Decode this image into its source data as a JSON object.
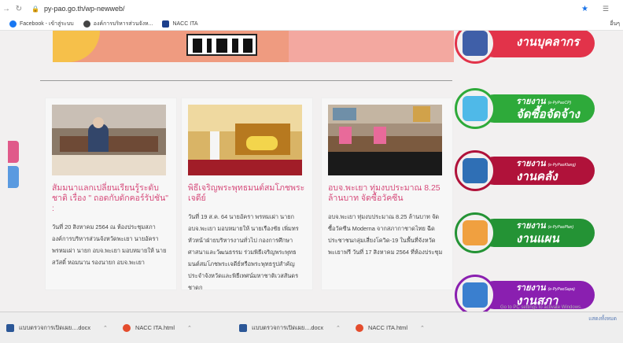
{
  "browser": {
    "url": "py-pao.go.th/wp-newweb/",
    "bookmarks": [
      {
        "label": "Facebook - เข้าสู่ระบบ",
        "color": "#1877f2"
      },
      {
        "label": "องค์การบริหารส่วนจังห...",
        "color": "#444444"
      },
      {
        "label": "NACC ITA",
        "color": "#1c3f8c"
      }
    ],
    "bookmarks_right": "อื่นๆ"
  },
  "articles": [
    {
      "title": "สัมมนาแลกเปลี่ยนเรียนรู้ระดับชาติ เรื่อง \" ถอดกับดักคอร์รัปชัน\" :",
      "body": "วันที่ 20 สิงหาคม 2564 ณ ห้องประชุมสภาองค์การบริหารส่วนจังหวัดพะเยา นายอัครา พรหมเผ่า นายก อบจ.พะเยา มอบหมายให้ นายสวัสดิ์ หอมนาน รองนายก อบจ.พะเยา"
    },
    {
      "title": "พิธีเจริญพระพุทธมนต์สมโภชพระเจดีย์",
      "body": "วันที่ 19 ส.ค. 64 นายอัครา พรหมเผ่า นายก อบจ.พะเยา มอบหมายให้ นายเรืองชัย เพิ่มทรหัวหน้าฝ่ายบริหารงานทั่วไป กองการศึกษา ศาสนาและวัฒนธรรม ร่วมพิธีเจริญพระพุทธมนต์สมโภชพระเจดีย์หรือพระพุทธรูปสำคัญประจำจังหวัดและพิธีเทศน์มหาชาติเวสสันดรชาดก"
    },
    {
      "title": "อบจ.พะเยา ทุ่มงบประมาณ 8.25 ล้านบาท จัดซื้อวัคซีน",
      "body": "อบจ.พะเยา ทุ่มงบประมาณ 8.25 ล้านบาท จัดซื้อวัคซีน Moderna จากสภากาชาดไทย ฉีดประชาชนกลุ่มเสี่ยงโควิด-19 ในพื้นที่จังหวัดพะเยาฟรี วันที่ 17 สิงหาคม 2564 ที่ห้องประชุม"
    }
  ],
  "side_links": [
    {
      "l1": "",
      "sub": "",
      "l2": "งานบุคลากร",
      "color": "#e2334a"
    },
    {
      "l1": "รายงาน",
      "sub": "(e-PyPaoCP)",
      "l2": "จัดซื้อจัดจ้าง",
      "color": "#2eaa3a"
    },
    {
      "l1": "รายงาน",
      "sub": "(e-PyPaoKlang)",
      "l2": "งานคลัง",
      "color": "#b0123a"
    },
    {
      "l1": "รายงาน",
      "sub": "(e-PyPaoPlan)",
      "l2": "งานแผน",
      "color": "#249335"
    },
    {
      "l1": "รายงาน",
      "sub": "(e-PyPaoSapa)",
      "l2": "งานสภา",
      "color": "#8a1fb0"
    }
  ],
  "watermark": "Go to PC settings to activate Windows.",
  "downloads": [
    {
      "name": "แบบตรวจการเปิดเผย....docx",
      "color": "#2b5797"
    },
    {
      "name": "NACC ITA.html",
      "color": "#e44c2d"
    },
    {
      "name": "แบบตรวจการเปิดเผย....docx",
      "color": "#2b5797"
    },
    {
      "name": "NACC ITA.html",
      "color": "#e44c2d"
    }
  ],
  "downloads_right": "แสดงทั้งหมด"
}
